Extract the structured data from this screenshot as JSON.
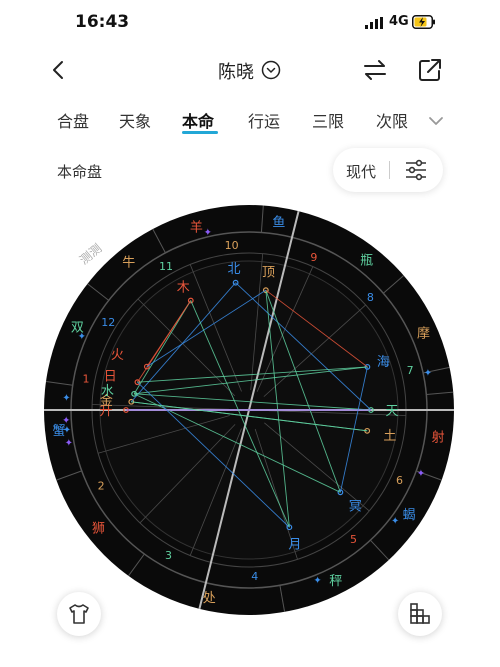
{
  "status_bar": {
    "time": "16:43",
    "network": "4G"
  },
  "nav": {
    "title": "陈晓"
  },
  "tabs": [
    {
      "label": "合盘"
    },
    {
      "label": "天象"
    },
    {
      "label": "本命",
      "active": true
    },
    {
      "label": "行运"
    },
    {
      "label": "三限"
    },
    {
      "label": "次限"
    }
  ],
  "chart_header": {
    "label": "本命盘",
    "mode": "现代"
  },
  "colors": {
    "accent": "#22a7d6",
    "fire": "#e8553a",
    "earth": "#d9a05b",
    "air": "#5fd1a0",
    "water": "#3a8de8"
  },
  "natal_chart": {
    "watermark": "测测",
    "signs": [
      {
        "label": "羊",
        "color": "#e8553a"
      },
      {
        "label": "牛",
        "color": "#d9a05b"
      },
      {
        "label": "双",
        "color": "#5fd1a0"
      },
      {
        "label": "蟹",
        "color": "#3a8de8"
      },
      {
        "label": "狮",
        "color": "#e8553a"
      },
      {
        "label": "处",
        "color": "#d9a05b"
      },
      {
        "label": "秤",
        "color": "#5fd1a0"
      },
      {
        "label": "蝎",
        "color": "#3a8de8"
      },
      {
        "label": "射",
        "color": "#e8553a"
      },
      {
        "label": "摩",
        "color": "#d9a05b"
      },
      {
        "label": "瓶",
        "color": "#5fd1a0"
      },
      {
        "label": "鱼",
        "color": "#3a8de8"
      }
    ],
    "houses": [
      "1",
      "2",
      "3",
      "4",
      "5",
      "6",
      "7",
      "8",
      "9",
      "10",
      "11",
      "12"
    ],
    "planets": [
      {
        "label": "北",
        "color": "#3a8de8"
      },
      {
        "label": "顶",
        "color": "#d9a05b"
      },
      {
        "label": "木",
        "color": "#e8553a"
      },
      {
        "label": "海",
        "color": "#3a8de8"
      },
      {
        "label": "天",
        "color": "#5fd1a0"
      },
      {
        "label": "土",
        "color": "#d9a05b"
      },
      {
        "label": "冥",
        "color": "#3a8de8"
      },
      {
        "label": "月",
        "color": "#3a8de8"
      },
      {
        "label": "升",
        "color": "#e8553a"
      },
      {
        "label": "金",
        "color": "#d9a05b"
      },
      {
        "label": "水",
        "color": "#5fd1a0"
      },
      {
        "label": "日",
        "color": "#e8553a"
      },
      {
        "label": "火",
        "color": "#e8553a"
      }
    ]
  }
}
